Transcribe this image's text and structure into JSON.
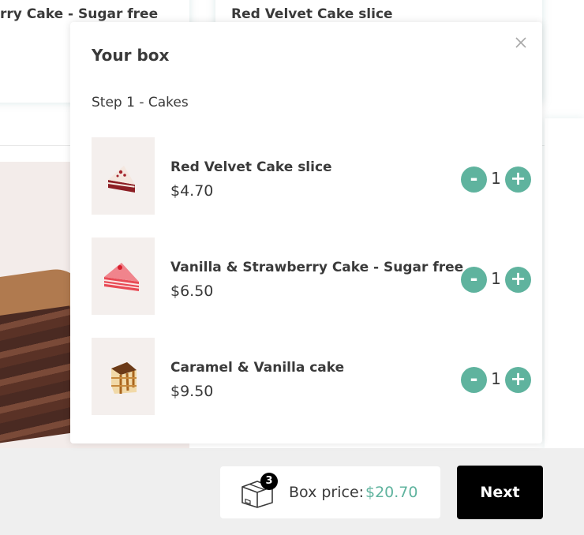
{
  "background": {
    "card_left_title": "rry Cake - Sugar free",
    "card_right_title": "Red Velvet Cake slice"
  },
  "modal": {
    "title": "Your box",
    "close_icon": "close-icon",
    "step_label": "Step 1 - Cakes",
    "items": [
      {
        "name": "Red Velvet Cake slice",
        "price": "$4.70",
        "quantity": "1",
        "minus": "-",
        "plus": "+"
      },
      {
        "name": "Vanilla & Strawberry Cake - Sugar free",
        "price": "$6.50",
        "quantity": "1",
        "minus": "-",
        "plus": "+"
      },
      {
        "name": "Caramel & Vanilla cake",
        "price": "$9.50",
        "quantity": "1",
        "minus": "-",
        "plus": "+"
      }
    ]
  },
  "footer": {
    "box_icon": "box-icon",
    "box_count": "3",
    "price_label": "Box price:",
    "price_value": "$20.70",
    "next_label": "Next"
  },
  "colors": {
    "accent": "#5fb39e",
    "button_dark": "#000000",
    "thumb_bg": "#f4efed"
  }
}
